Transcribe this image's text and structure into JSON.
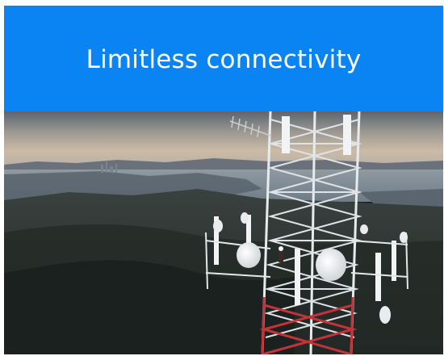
{
  "banner": {
    "title": "Limitless connectivity",
    "background_color": "#0a84f2",
    "text_color": "#ffffff"
  },
  "hero_image": {
    "subject": "cell-tower-photo"
  }
}
